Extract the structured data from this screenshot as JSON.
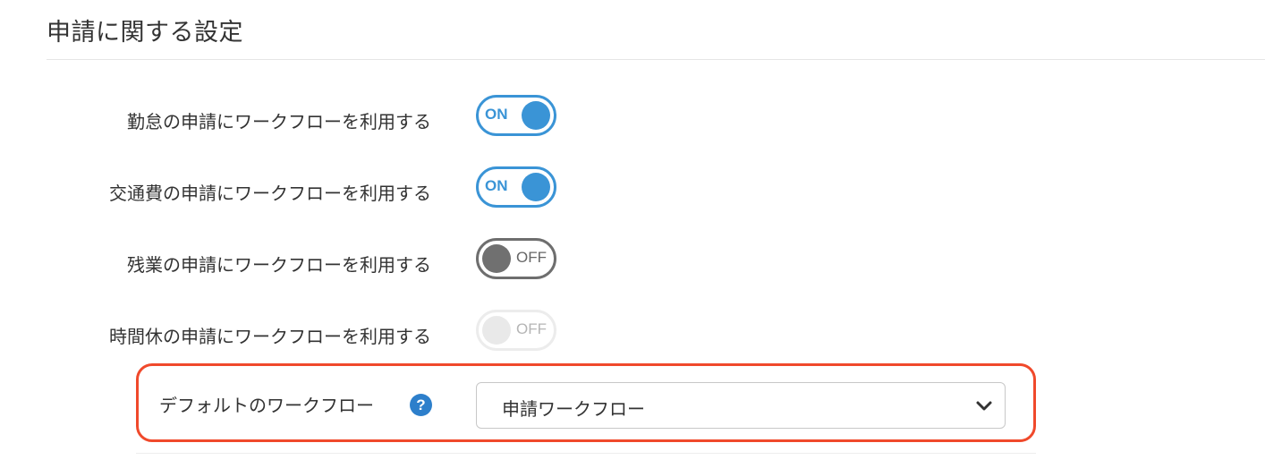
{
  "section": {
    "title": "申請に関する設定"
  },
  "settings": [
    {
      "label": "勤怠の申請にワークフローを利用する",
      "state": "ON",
      "enabled": true
    },
    {
      "label": "交通費の申請にワークフローを利用する",
      "state": "ON",
      "enabled": true
    },
    {
      "label": "残業の申請にワークフローを利用する",
      "state": "OFF",
      "enabled": true
    },
    {
      "label": "時間休の申請にワークフローを利用する",
      "state": "OFF",
      "enabled": false
    }
  ],
  "default_workflow": {
    "label": "デフォルトのワークフロー",
    "help_icon": "question-circle-icon",
    "help_glyph": "?",
    "selected": "申請ワークフロー",
    "dropdown_icon": "chevron-down-icon"
  },
  "colors": {
    "accent": "#3a94d6",
    "toggle_off": "#707070",
    "highlight": "#f0492b",
    "help_icon": "#2d7fcb"
  }
}
